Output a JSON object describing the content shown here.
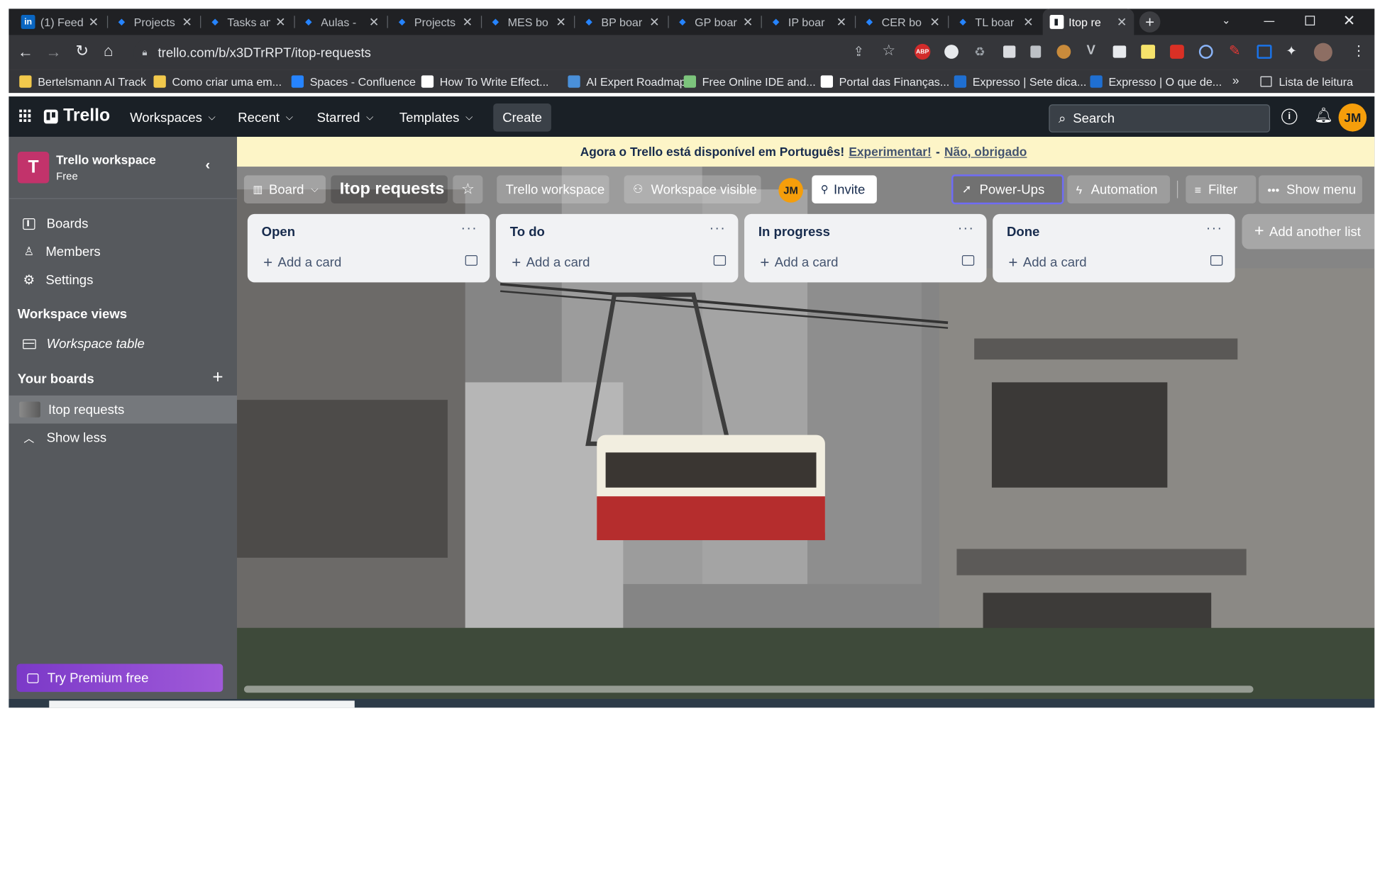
{
  "browser": {
    "tabs": [
      {
        "title": "(1) Feed",
        "favicon": "linkedin-icon",
        "color": "#0a66c2",
        "glyph": "in"
      },
      {
        "title": "Projects",
        "favicon": "jira-icon",
        "color": "#2684ff",
        "glyph": "◆"
      },
      {
        "title": "Tasks and",
        "favicon": "jira-icon",
        "color": "#2684ff",
        "glyph": "◆"
      },
      {
        "title": "Aulas -",
        "favicon": "jira-icon",
        "color": "#2684ff",
        "glyph": "◆"
      },
      {
        "title": "Projects",
        "favicon": "jira-icon",
        "color": "#2684ff",
        "glyph": "◆"
      },
      {
        "title": "MES bo",
        "favicon": "jira-icon",
        "color": "#2684ff",
        "glyph": "◆"
      },
      {
        "title": "BP boar",
        "favicon": "jira-icon",
        "color": "#2684ff",
        "glyph": "◆"
      },
      {
        "title": "GP boar",
        "favicon": "jira-icon",
        "color": "#2684ff",
        "glyph": "◆"
      },
      {
        "title": "IP boar",
        "favicon": "jira-icon",
        "color": "#2684ff",
        "glyph": "◆"
      },
      {
        "title": "CER bo",
        "favicon": "jira-icon",
        "color": "#2684ff",
        "glyph": "◆"
      },
      {
        "title": "TL boar",
        "favicon": "jira-icon",
        "color": "#2684ff",
        "glyph": "◆"
      },
      {
        "title": "Itop re",
        "favicon": "trello-icon",
        "color": "#ffffff",
        "glyph": "▮",
        "active": true
      }
    ],
    "url": "trello.com/b/x3DTrRPT/itop-requests",
    "bookmarks": [
      {
        "label": "Bertelsmann AI Track",
        "icon": "folder-icon",
        "color": "#f2c94c"
      },
      {
        "label": "Como criar uma em...",
        "icon": "folder-icon",
        "color": "#f2c94c"
      },
      {
        "label": "Spaces - Confluence",
        "icon": "confluence-icon",
        "color": "#2684ff"
      },
      {
        "label": "How To Write Effect...",
        "icon": "cf-icon",
        "color": "#ffffff"
      },
      {
        "label": "AI Expert Roadmap",
        "icon": "roadmap-icon",
        "color": "#4a90d9"
      },
      {
        "label": "Free Online IDE and...",
        "icon": "ide-icon",
        "color": "#7cc47c"
      },
      {
        "label": "Portal das Finanças...",
        "icon": "finance-icon",
        "color": "#ffffff"
      },
      {
        "label": "Expresso | Sete dica...",
        "icon": "expresso-icon",
        "color": "#1f6fd1"
      },
      {
        "label": "Expresso | O que de...",
        "icon": "expresso-icon",
        "color": "#1f6fd1"
      }
    ],
    "bookmarks_overflow": "»",
    "reading_list": "Lista de leitura"
  },
  "header": {
    "brand": "Trello",
    "nav": [
      "Workspaces",
      "Recent",
      "Starred",
      "Templates"
    ],
    "create": "Create",
    "search_placeholder": "Search",
    "avatar": "JM",
    "avatar_color": "#f59e0b"
  },
  "sidebar": {
    "workspace_initial": "T",
    "workspace_name": "Trello workspace",
    "workspace_plan": "Free",
    "items": [
      {
        "label": "Boards",
        "icon": "boards-icon"
      },
      {
        "label": "Members",
        "icon": "members-icon"
      },
      {
        "label": "Settings",
        "icon": "settings-icon"
      }
    ],
    "views_heading": "Workspace views",
    "workspace_table": "Workspace table",
    "your_boards_heading": "Your boards",
    "board_item": "Itop requests",
    "show_less": "Show less",
    "premium": "Try Premium free"
  },
  "banner": {
    "text": "Agora o Trello está disponível em Português!",
    "try": "Experimentar!",
    "sep": "-",
    "dismiss": "Não, obrigado"
  },
  "board": {
    "view": "Board",
    "title": "Itop requests",
    "workspace": "Trello workspace",
    "visibility": "Workspace visible",
    "member": "JM",
    "invite": "Invite",
    "powerups": "Power-Ups",
    "automation": "Automation",
    "filter": "Filter",
    "show_menu": "Show menu",
    "lists": [
      {
        "title": "Open",
        "add": "Add a card"
      },
      {
        "title": "To do",
        "add": "Add a card"
      },
      {
        "title": "In progress",
        "add": "Add a card"
      },
      {
        "title": "Done",
        "add": "Add a card"
      }
    ],
    "add_list": "Add another list"
  },
  "colors": {
    "trello_dark": "#1a2026",
    "sidebar": "#56595d",
    "workspace_tile": "#c2336b",
    "premium": "#8b49c9"
  }
}
